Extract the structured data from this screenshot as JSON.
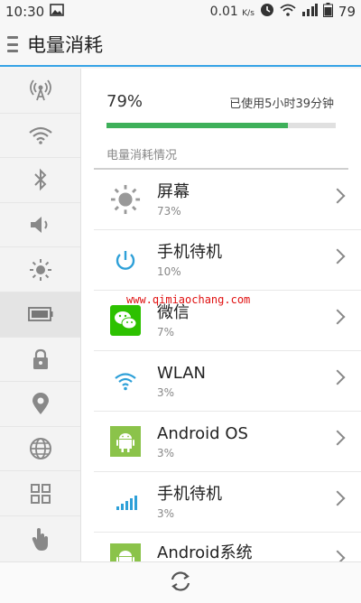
{
  "status": {
    "time": "10:30",
    "speed": "0.01",
    "speed_unit": "K/s",
    "battery": "79"
  },
  "header": {
    "title": "电量消耗"
  },
  "summary": {
    "percent": "79%",
    "used": "已使用5小时39分钟",
    "level": 0.79
  },
  "section": {
    "label": "电量消耗情况"
  },
  "items": [
    {
      "name": "屏幕",
      "percent": "73%",
      "icon": "brightness-icon"
    },
    {
      "name": "手机待机",
      "percent": "10%",
      "icon": "power-icon"
    },
    {
      "name": "微信",
      "percent": "7%",
      "icon": "wechat-icon"
    },
    {
      "name": "WLAN",
      "percent": "3%",
      "icon": "wifi-icon"
    },
    {
      "name": "Android OS",
      "percent": "3%",
      "icon": "android-icon"
    },
    {
      "name": "手机待机",
      "percent": "3%",
      "icon": "signal-icon"
    },
    {
      "name": "Android系统",
      "percent": "",
      "icon": "android-icon"
    }
  ],
  "sidebar": [
    "hotspot-icon",
    "wifi-icon",
    "bluetooth-icon",
    "sound-icon",
    "brightness-icon",
    "battery-icon",
    "lock-icon",
    "location-icon",
    "globe-icon",
    "apps-icon",
    "touch-icon"
  ],
  "watermark": "www.qimiaochang.com",
  "colors": {
    "accent": "#36a3e6",
    "progress": "#3eb05a",
    "wechat": "#2dc100",
    "android": "#8bc34a"
  }
}
